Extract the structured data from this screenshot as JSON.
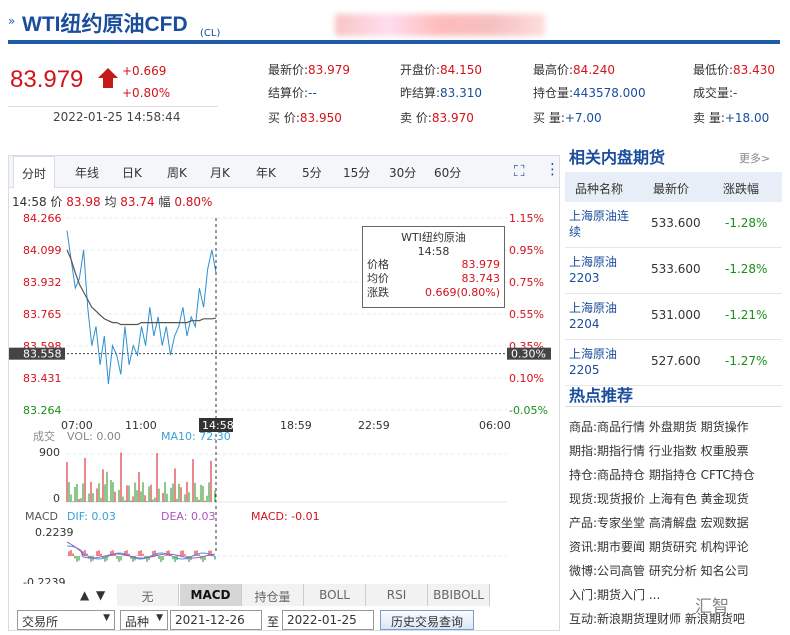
{
  "header": {
    "title": "WTI纽约原油CFD",
    "code": "(CL)",
    "price": "83.979",
    "change": "+0.669",
    "change_pct": "+0.80%",
    "timestamp": "2022-01-25 14:58:44"
  },
  "quotes": [
    {
      "label": "最新价:",
      "value": "83.979",
      "color": "red"
    },
    {
      "label": "开盘价:",
      "value": "84.150",
      "color": "red"
    },
    {
      "label": "最高价:",
      "value": "84.240",
      "color": "red"
    },
    {
      "label": "最低价:",
      "value": "83.430",
      "color": "red"
    },
    {
      "label": "结算价:",
      "value": "--",
      "color": "blue"
    },
    {
      "label": "昨结算:",
      "value": "83.310",
      "color": "blue"
    },
    {
      "label": "持仓量:",
      "value": "443578.000",
      "color": "blue"
    },
    {
      "label": "成交量:",
      "value": "-",
      "color": "blue"
    },
    {
      "label": "买  价:",
      "value": "83.950",
      "color": "red"
    },
    {
      "label": "卖  价:",
      "value": "83.970",
      "color": "red"
    },
    {
      "label": "买  量:",
      "value": "+7.00",
      "color": "blue"
    },
    {
      "label": "卖  量:",
      "value": "+18.00",
      "color": "blue"
    }
  ],
  "tabs": [
    "分时",
    "年线",
    "日K",
    "周K",
    "月K",
    "年K",
    "5分",
    "15分",
    "30分",
    "60分"
  ],
  "info_line": {
    "time": "14:58",
    "price_label": "价",
    "price": "83.98",
    "avg_label": "均",
    "avg": "83.74",
    "amp_label": "幅",
    "amp": "0.80%"
  },
  "y_left": [
    "84.266",
    "84.099",
    "83.932",
    "83.765",
    "83.598",
    "83.558",
    "83.431",
    "83.264"
  ],
  "y_right": [
    "1.15%",
    "0.95%",
    "0.75%",
    "0.55%",
    "0.35%",
    "0.30%",
    "0.10%",
    "-0.05%"
  ],
  "x_labels": [
    "07:00",
    "11:00",
    "14:58",
    "18:59",
    "22:59",
    "06:00"
  ],
  "tooltip": {
    "title": "WTI纽约原油",
    "time": "14:58",
    "rows": [
      {
        "label": "价格",
        "value": "83.979"
      },
      {
        "label": "均价",
        "value": "83.743"
      },
      {
        "label": "涨跌",
        "value": "0.669(0.80%)"
      }
    ]
  },
  "volume": {
    "label": "成交",
    "vol": "VOL: 0.00",
    "ma": "MA10: 72.30",
    "max": "900",
    "zero": "0"
  },
  "macd": {
    "label": "MACD",
    "dif": "DIF: 0.03",
    "dea": "DEA: 0.03",
    "macd": "MACD: -0.01",
    "top": "0.2239",
    "bottom": "-0.2239"
  },
  "indicator_tabs": [
    "无",
    "MACD",
    "持仓量",
    "BOLL",
    "RSI",
    "BBIBOLL"
  ],
  "controls": {
    "exchange": "交易所",
    "variety": "品种",
    "start": "2021-12-26",
    "to": "至",
    "end": "2022-01-25",
    "query": "历史交易查询"
  },
  "related": {
    "title": "相关内盘期货",
    "more": "更多>",
    "headers": [
      "品种名称",
      "最新价",
      "涨跌幅"
    ],
    "rows": [
      {
        "name": "上海原油连续",
        "price": "533.600",
        "pct": "-1.28%"
      },
      {
        "name": "上海原油2203",
        "price": "533.600",
        "pct": "-1.28%"
      },
      {
        "name": "上海原油2204",
        "price": "531.000",
        "pct": "-1.21%"
      },
      {
        "name": "上海原油2205",
        "price": "527.600",
        "pct": "-1.27%"
      }
    ]
  },
  "hot": {
    "title": "热点推荐",
    "rows": [
      {
        "cat": "商品:",
        "items": "商品行情 外盘期货 期货操作"
      },
      {
        "cat": "期指:",
        "items": "期指行情 行业指数 权重股票"
      },
      {
        "cat": "持仓:",
        "items": "商品持仓 期指持仓 CFTC持仓"
      },
      {
        "cat": "现货:",
        "items": "现货报价 上海有色 黄金现货"
      },
      {
        "cat": "产品:",
        "items": "专家坐堂 高清解盘 宏观数据"
      },
      {
        "cat": "资讯:",
        "items": "期市要闻 期货研究 机构评论"
      },
      {
        "cat": "微博:",
        "items": "公司高管 研究分析 知名公司"
      },
      {
        "cat": "入门:",
        "items": "期货入门 ..."
      },
      {
        "cat": "互动:",
        "items": "新浪期货理财师 新浪期货吧"
      }
    ],
    "watermark": "汇智"
  },
  "chart_data": {
    "type": "line",
    "title": "",
    "ylim": [
      83.264,
      84.266
    ],
    "xlabel": "",
    "ylabel": "",
    "series": [
      {
        "name": "价格",
        "values": [
          84.2,
          84.05,
          83.9,
          83.95,
          84.1,
          83.8,
          83.6,
          83.7,
          83.5,
          83.65,
          83.4,
          83.6,
          83.55,
          83.45,
          83.7,
          83.5,
          83.6,
          83.55,
          83.7,
          83.6,
          83.8,
          83.65,
          83.75,
          83.6,
          83.7,
          83.55,
          83.65,
          83.7,
          83.8,
          83.65,
          83.75,
          83.7,
          83.9,
          83.8,
          84.0,
          84.1,
          83.98
        ]
      },
      {
        "name": "均价",
        "values": [
          84.1,
          84.05,
          83.98,
          83.92,
          83.88,
          83.84,
          83.8,
          83.78,
          83.76,
          83.74,
          83.73,
          83.72,
          83.72,
          83.71,
          83.71,
          83.71,
          83.71,
          83.71,
          83.72,
          83.72,
          83.72,
          83.72,
          83.72,
          83.72,
          83.72,
          83.72,
          83.72,
          83.72,
          83.72,
          83.72,
          83.73,
          83.73,
          83.73,
          83.74,
          83.74,
          83.74,
          83.743
        ]
      }
    ]
  }
}
